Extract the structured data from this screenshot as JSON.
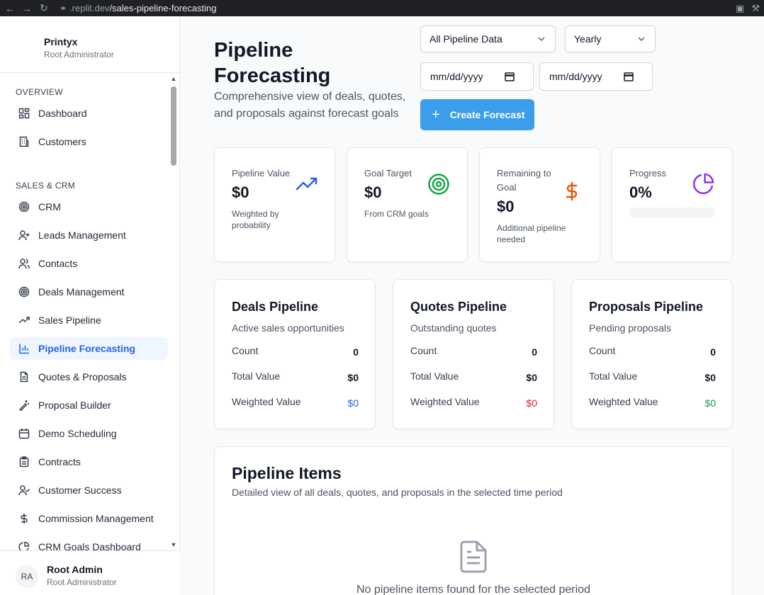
{
  "browser": {
    "url_host": ".replit.dev",
    "url_path": "/sales-pipeline-forecasting"
  },
  "sidebar": {
    "brand_name": "Printyx",
    "brand_role": "Root Administrator",
    "sections": {
      "overview": "OVERVIEW",
      "sales": "SALES & CRM"
    },
    "items": [
      {
        "label": "Dashboard",
        "icon": "grid-icon"
      },
      {
        "label": "Customers",
        "icon": "building-icon"
      },
      {
        "label": "CRM",
        "icon": "target-icon"
      },
      {
        "label": "Leads Management",
        "icon": "user-plus-icon"
      },
      {
        "label": "Contacts",
        "icon": "users-icon"
      },
      {
        "label": "Deals Management",
        "icon": "target-icon"
      },
      {
        "label": "Sales Pipeline",
        "icon": "trending-up-icon"
      },
      {
        "label": "Pipeline Forecasting",
        "icon": "bar-chart-icon"
      },
      {
        "label": "Quotes & Proposals",
        "icon": "file-text-icon"
      },
      {
        "label": "Proposal Builder",
        "icon": "wand-icon"
      },
      {
        "label": "Demo Scheduling",
        "icon": "calendar-icon"
      },
      {
        "label": "Contracts",
        "icon": "clipboard-icon"
      },
      {
        "label": "Customer Success",
        "icon": "user-check-icon"
      },
      {
        "label": "Commission Management",
        "icon": "dollar-icon"
      },
      {
        "label": "CRM Goals Dashboard",
        "icon": "pie-chart-icon"
      }
    ],
    "user": {
      "initials": "RA",
      "name": "Root Admin",
      "role": "Root Administrator"
    }
  },
  "header": {
    "title": "Pipeline Forecasting",
    "subtitle": "Comprehensive view of deals, quotes, and proposals against forecast goals",
    "filter_type": "All Pipeline Data",
    "period": "Yearly",
    "start_date_placeholder": "mm/dd/yyyy",
    "end_date_placeholder": "mm/dd/yyyy",
    "create_button": "Create Forecast"
  },
  "stats": {
    "pipeline_value": {
      "label": "Pipeline Value",
      "value": "$0",
      "note": "Weighted by probability"
    },
    "goal_target": {
      "label": "Goal Target",
      "value": "$0",
      "note": "From CRM goals"
    },
    "remaining": {
      "label": "Remaining to Goal",
      "value": "$0",
      "note": "Additional pipeline needed"
    },
    "progress": {
      "label": "Progress",
      "value": "0%",
      "fraction": 0
    }
  },
  "pipelines": {
    "deals": {
      "title": "Deals Pipeline",
      "subtitle": "Active sales opportunities",
      "count_label": "Count",
      "count": "0",
      "total_label": "Total Value",
      "total": "$0",
      "weighted_label": "Weighted Value",
      "weighted": "$0"
    },
    "quotes": {
      "title": "Quotes Pipeline",
      "subtitle": "Outstanding quotes",
      "count_label": "Count",
      "count": "0",
      "total_label": "Total Value",
      "total": "$0",
      "weighted_label": "Weighted Value",
      "weighted": "$0"
    },
    "proposals": {
      "title": "Proposals Pipeline",
      "subtitle": "Pending proposals",
      "count_label": "Count",
      "count": "0",
      "total_label": "Total Value",
      "total": "$0",
      "weighted_label": "Weighted Value",
      "weighted": "$0"
    }
  },
  "items_panel": {
    "title": "Pipeline Items",
    "subtitle": "Detailed view of all deals, quotes, and proposals in the selected time period",
    "empty": "No pipeline items found for the selected period"
  },
  "colors": {
    "primary": "#3b9eeb",
    "active_nav": "#2563eb",
    "deals_weighted": "#2563eb",
    "quotes_weighted": "#dc2626",
    "proposals_weighted": "#16a34a",
    "goal_icon": "#16a34a",
    "remaining_icon": "#ea580c",
    "progress_icon": "#9333ea"
  }
}
